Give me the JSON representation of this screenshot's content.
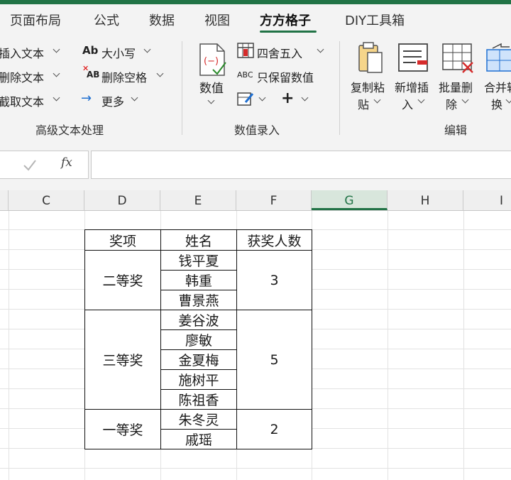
{
  "tabs": [
    "页面布局",
    "公式",
    "数据",
    "视图",
    "方方格子",
    "DIY工具箱"
  ],
  "active_tab": "方方格子",
  "accent_color": "#217346",
  "ribbon": {
    "group1": {
      "items": [
        "插入文本",
        "删除文本",
        "截取文本",
        "大小写",
        "删除空格",
        "更多"
      ],
      "label": "高级文本处理"
    },
    "group2": {
      "value_button": "数值",
      "items": [
        "四舍五入",
        "只保留数值"
      ],
      "label": "数值录入"
    },
    "group3": {
      "buttons": [
        {
          "line1": "复制粘",
          "line2": "贴"
        },
        {
          "line1": "新增插",
          "line2": "入"
        },
        {
          "line1": "批量删",
          "line2": "除"
        },
        {
          "line1": "合并转",
          "line2": "换"
        }
      ],
      "label": "编辑"
    }
  },
  "formula_bar": {
    "fx": "fx",
    "value": ""
  },
  "columns": [
    "C",
    "D",
    "E",
    "F",
    "G",
    "H",
    "I"
  ],
  "selected_column": "G",
  "table": {
    "headers": [
      "奖项",
      "姓名",
      "获奖人数"
    ],
    "groups": [
      {
        "award": "二等奖",
        "names": [
          "钱平夏",
          "韩重",
          "曹景燕"
        ],
        "count": "3"
      },
      {
        "award": "三等奖",
        "names": [
          "姜谷波",
          "廖敏",
          "金夏梅",
          "施树平",
          "陈祖香"
        ],
        "count": "5"
      },
      {
        "award": "一等奖",
        "names": [
          "朱冬灵",
          "戚瑶"
        ],
        "count": "2"
      }
    ]
  }
}
